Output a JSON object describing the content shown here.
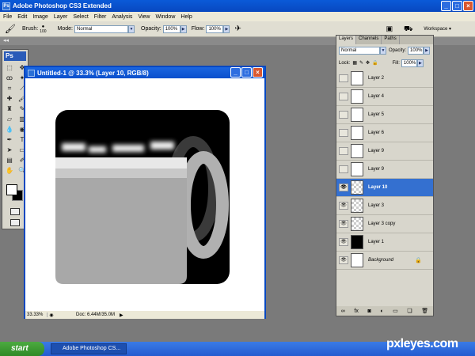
{
  "window": {
    "title": "Adobe Photoshop CS3 Extended"
  },
  "menu": [
    "File",
    "Edit",
    "Image",
    "Layer",
    "Select",
    "Filter",
    "Analysis",
    "View",
    "Window",
    "Help"
  ],
  "options": {
    "brush_label": "Brush:",
    "brush_size": "100",
    "mode_label": "Mode:",
    "mode_value": "Normal",
    "opacity_label": "Opacity:",
    "opacity_value": "100%",
    "flow_label": "Flow:",
    "flow_value": "100%",
    "workspace_label": "Workspace"
  },
  "tools": {
    "logo": "Ps"
  },
  "document": {
    "title": "Untitled-1 @ 33.3% (Layer 10, RGB/8)",
    "zoom": "33.33%",
    "doc_info": "Doc: 6.44M/35.0M"
  },
  "layers_panel": {
    "tabs": [
      "Layers",
      "Channels",
      "Paths"
    ],
    "blend_mode": "Normal",
    "opacity_label": "Opacity:",
    "opacity_value": "100%",
    "lock_label": "Lock:",
    "fill_label": "Fill:",
    "fill_value": "100%",
    "layers": [
      {
        "name": "Layer 2",
        "visible": false,
        "selected": false
      },
      {
        "name": "Layer 4",
        "visible": false,
        "selected": false
      },
      {
        "name": "Layer 5",
        "visible": false,
        "selected": false
      },
      {
        "name": "Layer 6",
        "visible": false,
        "selected": false
      },
      {
        "name": "Layer 9",
        "visible": false,
        "selected": false
      },
      {
        "name": "Layer 9",
        "visible": false,
        "selected": false
      },
      {
        "name": "Layer 10",
        "visible": true,
        "selected": true
      },
      {
        "name": "Layer 3",
        "visible": true,
        "selected": false
      },
      {
        "name": "Layer 3 copy",
        "visible": true,
        "selected": false
      },
      {
        "name": "Layer 1",
        "visible": true,
        "selected": false
      },
      {
        "name": "Background",
        "visible": true,
        "selected": false
      }
    ]
  },
  "taskbar": {
    "start_label": "start",
    "task_label": "Adobe Photoshop CS..."
  },
  "watermark": "pxleyes.com"
}
